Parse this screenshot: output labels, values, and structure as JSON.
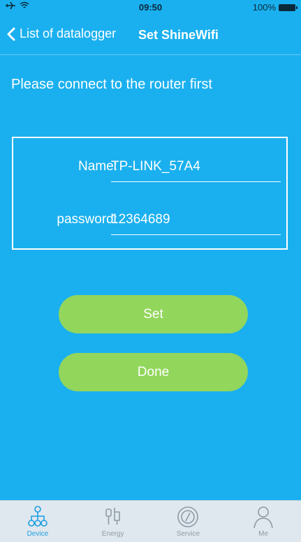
{
  "status": {
    "time": "09:50",
    "battery": "100%"
  },
  "nav": {
    "back_label": "List of datalogger",
    "title": "Set ShineWifi"
  },
  "instruction": "Please connect to the router first",
  "form": {
    "name_label": "Name:",
    "name_value": "TP-LINK_57A4",
    "password_label": "password:",
    "password_value": "12364689"
  },
  "buttons": {
    "set": "Set",
    "done": "Done"
  },
  "tabs": [
    {
      "label": "Device",
      "icon": "device-icon",
      "active": true
    },
    {
      "label": "Energy",
      "icon": "energy-icon",
      "active": false
    },
    {
      "label": "Service",
      "icon": "service-icon",
      "active": false
    },
    {
      "label": "Me",
      "icon": "me-icon",
      "active": false
    }
  ],
  "colors": {
    "background": "#1ab0ef",
    "button": "#92d65c",
    "tab_active": "#1d9ee0",
    "tab_inactive": "#8f9aa3"
  }
}
